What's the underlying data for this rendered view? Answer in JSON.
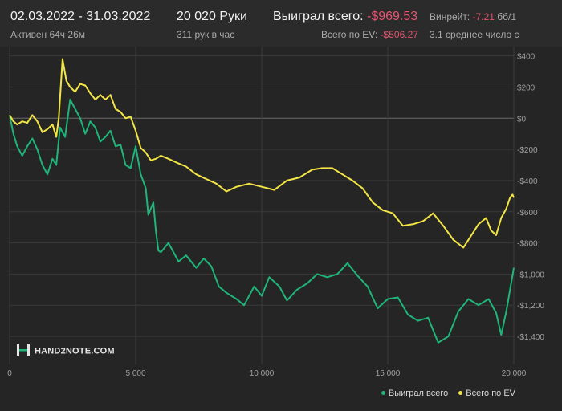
{
  "header": {
    "date_range": "02.03.2022 - 31.03.2022",
    "active_time": "Активен 64ч 26м",
    "hands": "20 020 Руки",
    "hands_per_hour": "311 рук в час",
    "won_label": "Выиграл всего:",
    "won_value": "-$969.53",
    "ev_label": "Всего по EV:",
    "ev_value": "-$506.27",
    "winrate_label": "Винрейт:",
    "winrate_value": "-7.21",
    "winrate_rest": "бб/1",
    "avg_text": "3.1 среднее число с"
  },
  "brand": {
    "name": "HAND2NOTE.COM"
  },
  "colors": {
    "won": "#1fb57a",
    "ev": "#f2e545",
    "grid": "#3a3a3a",
    "zero": "#6a6a6a",
    "text": "#a0a0a0"
  },
  "chart_data": {
    "type": "line",
    "x_ticks": [
      0,
      5000,
      10000,
      15000,
      20000
    ],
    "x_tick_labels": [
      "0",
      "5 000",
      "10 000",
      "15 000",
      "20 000"
    ],
    "y_ticks": [
      400,
      200,
      0,
      -200,
      -400,
      -600,
      -800,
      -1000,
      -1200,
      -1400
    ],
    "y_tick_labels": [
      "$400",
      "$200",
      "$0",
      "-$200",
      "-$400",
      "-$600",
      "-$800",
      "-$1,000",
      "-$1,200",
      "-$1,400"
    ],
    "xlim": [
      0,
      20000
    ],
    "ylim": [
      -1580,
      460
    ],
    "grid": true,
    "legend_position": "bottom-right",
    "series": [
      {
        "name": "Выиграл всего",
        "color": "#1fb57a",
        "points": [
          [
            0,
            20
          ],
          [
            150,
            -100
          ],
          [
            300,
            -180
          ],
          [
            500,
            -240
          ],
          [
            700,
            -180
          ],
          [
            900,
            -130
          ],
          [
            1100,
            -200
          ],
          [
            1300,
            -300
          ],
          [
            1500,
            -360
          ],
          [
            1700,
            -260
          ],
          [
            1850,
            -300
          ],
          [
            2000,
            -60
          ],
          [
            2200,
            -120
          ],
          [
            2400,
            120
          ],
          [
            2600,
            60
          ],
          [
            2800,
            0
          ],
          [
            3000,
            -100
          ],
          [
            3200,
            -20
          ],
          [
            3400,
            -60
          ],
          [
            3600,
            -150
          ],
          [
            3800,
            -120
          ],
          [
            4000,
            -80
          ],
          [
            4200,
            -180
          ],
          [
            4400,
            -170
          ],
          [
            4600,
            -300
          ],
          [
            4800,
            -320
          ],
          [
            5000,
            -180
          ],
          [
            5200,
            -360
          ],
          [
            5400,
            -450
          ],
          [
            5500,
            -620
          ],
          [
            5700,
            -540
          ],
          [
            5800,
            -720
          ],
          [
            5900,
            -850
          ],
          [
            6000,
            -860
          ],
          [
            6300,
            -800
          ],
          [
            6700,
            -920
          ],
          [
            7000,
            -880
          ],
          [
            7400,
            -960
          ],
          [
            7700,
            -900
          ],
          [
            8000,
            -950
          ],
          [
            8300,
            -1080
          ],
          [
            8600,
            -1120
          ],
          [
            9000,
            -1160
          ],
          [
            9300,
            -1200
          ],
          [
            9700,
            -1080
          ],
          [
            10000,
            -1140
          ],
          [
            10300,
            -1020
          ],
          [
            10700,
            -1080
          ],
          [
            11000,
            -1170
          ],
          [
            11400,
            -1100
          ],
          [
            11800,
            -1060
          ],
          [
            12200,
            -1000
          ],
          [
            12600,
            -1020
          ],
          [
            13000,
            -1000
          ],
          [
            13400,
            -930
          ],
          [
            13800,
            -1010
          ],
          [
            14200,
            -1080
          ],
          [
            14600,
            -1220
          ],
          [
            15000,
            -1160
          ],
          [
            15400,
            -1150
          ],
          [
            15800,
            -1260
          ],
          [
            16200,
            -1300
          ],
          [
            16600,
            -1280
          ],
          [
            17000,
            -1440
          ],
          [
            17400,
            -1400
          ],
          [
            17800,
            -1240
          ],
          [
            18200,
            -1160
          ],
          [
            18600,
            -1200
          ],
          [
            19000,
            -1160
          ],
          [
            19300,
            -1250
          ],
          [
            19500,
            -1390
          ],
          [
            19700,
            -1240
          ],
          [
            19850,
            -1100
          ],
          [
            20000,
            -960
          ]
        ]
      },
      {
        "name": "Всего по EV",
        "color": "#f2e545",
        "points": [
          [
            0,
            20
          ],
          [
            150,
            -20
          ],
          [
            300,
            -40
          ],
          [
            500,
            -20
          ],
          [
            700,
            -30
          ],
          [
            900,
            20
          ],
          [
            1100,
            -20
          ],
          [
            1300,
            -90
          ],
          [
            1500,
            -70
          ],
          [
            1700,
            -40
          ],
          [
            1850,
            -120
          ],
          [
            1950,
            0
          ],
          [
            2100,
            380
          ],
          [
            2250,
            240
          ],
          [
            2400,
            200
          ],
          [
            2600,
            170
          ],
          [
            2800,
            220
          ],
          [
            3000,
            210
          ],
          [
            3200,
            160
          ],
          [
            3400,
            120
          ],
          [
            3600,
            150
          ],
          [
            3800,
            120
          ],
          [
            4000,
            150
          ],
          [
            4200,
            60
          ],
          [
            4400,
            40
          ],
          [
            4600,
            0
          ],
          [
            4800,
            10
          ],
          [
            5000,
            -80
          ],
          [
            5200,
            -190
          ],
          [
            5400,
            -220
          ],
          [
            5600,
            -270
          ],
          [
            5800,
            -260
          ],
          [
            6000,
            -240
          ],
          [
            6300,
            -260
          ],
          [
            6700,
            -290
          ],
          [
            7000,
            -310
          ],
          [
            7400,
            -360
          ],
          [
            7800,
            -390
          ],
          [
            8200,
            -420
          ],
          [
            8600,
            -470
          ],
          [
            9000,
            -440
          ],
          [
            9500,
            -420
          ],
          [
            10000,
            -440
          ],
          [
            10500,
            -460
          ],
          [
            11000,
            -400
          ],
          [
            11500,
            -380
          ],
          [
            12000,
            -330
          ],
          [
            12400,
            -320
          ],
          [
            12800,
            -320
          ],
          [
            13200,
            -360
          ],
          [
            13600,
            -400
          ],
          [
            14000,
            -450
          ],
          [
            14400,
            -540
          ],
          [
            14800,
            -590
          ],
          [
            15200,
            -610
          ],
          [
            15600,
            -690
          ],
          [
            16000,
            -680
          ],
          [
            16400,
            -660
          ],
          [
            16800,
            -610
          ],
          [
            17200,
            -690
          ],
          [
            17600,
            -780
          ],
          [
            18000,
            -830
          ],
          [
            18200,
            -780
          ],
          [
            18600,
            -680
          ],
          [
            18900,
            -640
          ],
          [
            19100,
            -720
          ],
          [
            19300,
            -750
          ],
          [
            19500,
            -640
          ],
          [
            19700,
            -580
          ],
          [
            19850,
            -510
          ],
          [
            19950,
            -490
          ],
          [
            20000,
            -510
          ]
        ]
      }
    ]
  }
}
